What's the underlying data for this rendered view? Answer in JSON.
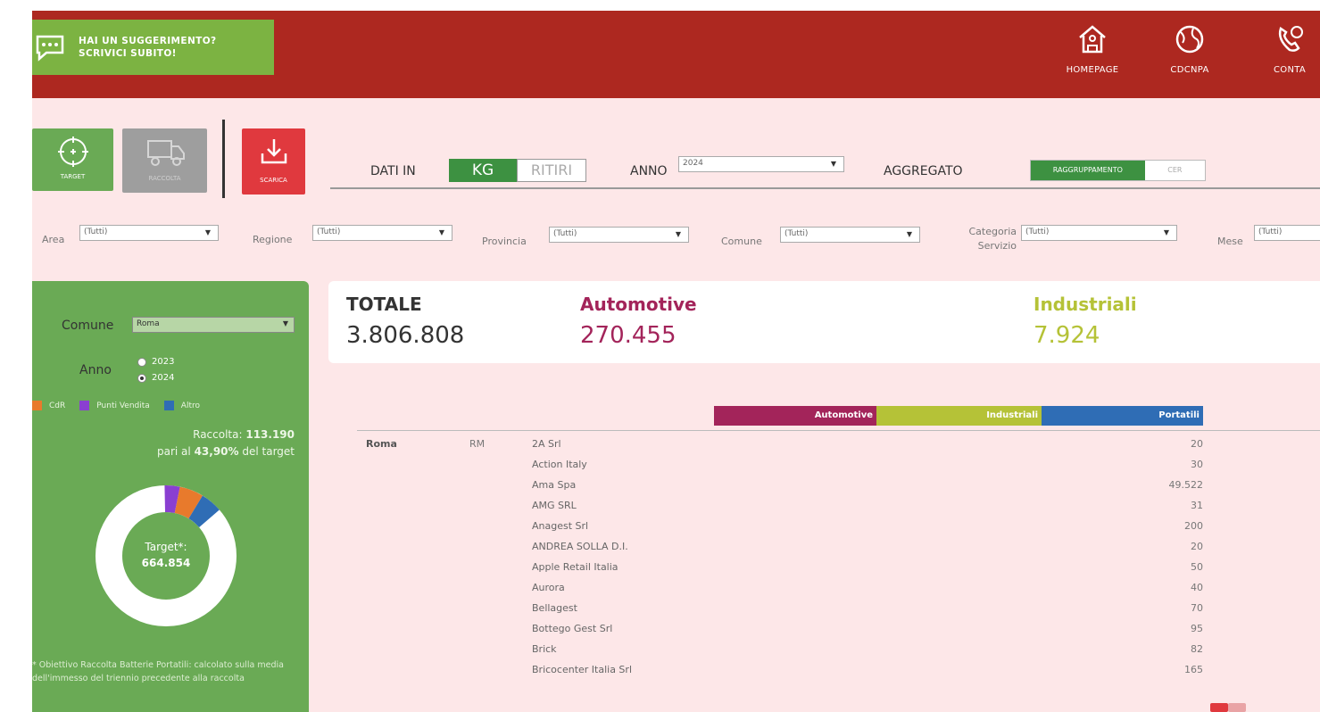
{
  "header": {
    "suggest_line1": "HAI UN SUGGERIMENTO?",
    "suggest_line2": "SCRIVICI SUBITO!",
    "nav": [
      "HOMEPAGE",
      "CDCNPA",
      "CONTA"
    ]
  },
  "toolbar": {
    "target_label": "TARGET",
    "raccolta_label": "RACCOLTA",
    "scarica_label": "SCARICA",
    "dati_in_label": "DATI IN",
    "kg_label": "KG",
    "ritiri_label": "RITIRI",
    "anno_label": "ANNO",
    "anno_value": "2024",
    "aggregato_label": "AGGREGATO",
    "raggruppamento_label": "RAGGRUPPAMENTO",
    "cer_label": "CER"
  },
  "filters": {
    "area_label": "Area",
    "area_value": "(Tutti)",
    "regione_label": "Regione",
    "regione_value": "(Tutti)",
    "provincia_label": "Provincia",
    "provincia_value": "(Tutti)",
    "comune_label": "Comune",
    "comune_value": "(Tutti)",
    "categoria_label1": "Categoria",
    "categoria_label2": "Servizio",
    "categoria_value": "(Tutti)",
    "mese_label": "Mese",
    "mese_value": "(Tutti)"
  },
  "left_panel": {
    "comune_label": "Comune",
    "comune_value": "Roma",
    "anno_label": "Anno",
    "years": [
      "2023",
      "2024"
    ],
    "selected_year": "2024",
    "legend": [
      {
        "label": "CdR",
        "color": "#e87a2c"
      },
      {
        "label": "Punti Vendita",
        "color": "#8a3fd1"
      },
      {
        "label": "Altro",
        "color": "#2f6db5"
      }
    ],
    "raccolta_prefix": "Raccolta: ",
    "raccolta_value": "113.190",
    "pari_prefix": "pari al ",
    "pari_value": "43,90%",
    "pari_suffix": " del target",
    "target_label": "Target*:",
    "target_value": "664.854",
    "note": "* Obiettivo Raccolta Batterie Portatili: calcolato sulla media dell'immesso del triennio precedente alla raccolta",
    "donut_segments": [
      {
        "name": "Punti Vendita",
        "fraction": 0.035,
        "color": "#8a3fd1"
      },
      {
        "name": "CdR",
        "fraction": 0.055,
        "color": "#e87a2c"
      },
      {
        "name": "Altro",
        "fraction": 0.05,
        "color": "#2f6db5"
      }
    ]
  },
  "kpi": {
    "totale_label": "TOTALE",
    "totale_value": "3.806.808",
    "automotive_label": "Automotive",
    "automotive_value": "270.455",
    "industriali_label": "Industriali",
    "industriali_value": "7.924",
    "automotive_color": "#a3245a",
    "industriali_color": "#b5c237"
  },
  "table": {
    "headers": [
      "Automotive",
      "Industriali",
      "Portatili"
    ],
    "header_colors": [
      "#a3245a",
      "#b5c237",
      "#2f6db5"
    ],
    "comune": "Roma",
    "provincia": "RM",
    "rows": [
      {
        "name": "2A Srl",
        "value": "20"
      },
      {
        "name": "Action Italy",
        "value": "30"
      },
      {
        "name": "Ama Spa",
        "value": "49.522"
      },
      {
        "name": "AMG SRL",
        "value": "31"
      },
      {
        "name": "Anagest Srl",
        "value": "200"
      },
      {
        "name": "ANDREA SOLLA D.I.",
        "value": "20"
      },
      {
        "name": "Apple Retail Italia",
        "value": "50"
      },
      {
        "name": "Aurora",
        "value": "40"
      },
      {
        "name": "Bellagest",
        "value": "70"
      },
      {
        "name": "Bottego Gest Srl",
        "value": "95"
      },
      {
        "name": "Brick",
        "value": "82"
      },
      {
        "name": "Bricocenter Italia Srl",
        "value": "165"
      }
    ]
  }
}
